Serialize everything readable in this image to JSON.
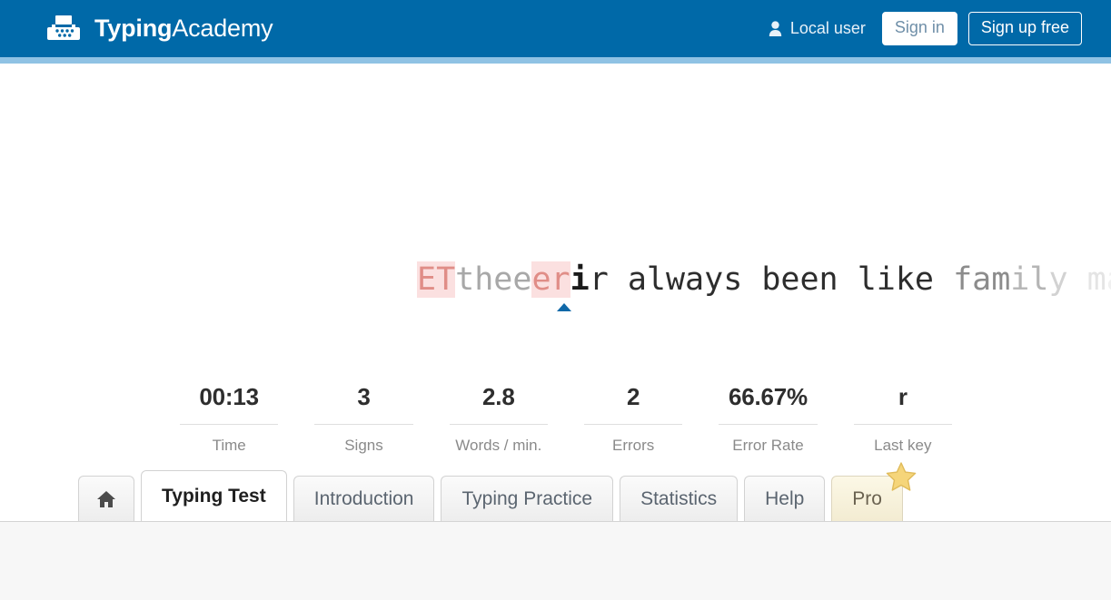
{
  "header": {
    "brand_strong": "Typing",
    "brand_light": "Academy",
    "brand_icon": "typewriter-icon",
    "user_icon": "person-icon",
    "user_label": "Local user",
    "sign_in_label": "Sign in",
    "sign_up_label": "Sign up free",
    "background_color": "#0069a8",
    "accent_color": "#8fc2e4"
  },
  "typing": {
    "segments": [
      {
        "text": "ET",
        "state": "error"
      },
      {
        "text": "thee",
        "state": "done"
      },
      {
        "text": "er",
        "state": "error"
      },
      {
        "text": "i",
        "state": "current"
      },
      {
        "text": "r always been like ",
        "state": "todo"
      },
      {
        "text": "fam",
        "state": "fade1"
      },
      {
        "text": "il",
        "state": "fade2"
      },
      {
        "text": "y",
        "state": "fade3"
      },
      {
        "text": " m",
        "state": "fade4"
      },
      {
        "text": "a",
        "state": "fade5"
      }
    ],
    "caret_icon": "caret-triangle-icon",
    "caret_color": "#1068a8",
    "error_text_color": "#e08d87",
    "error_bg_color": "#fbe0e0"
  },
  "stats": [
    {
      "value": "00:13",
      "label": "Time"
    },
    {
      "value": "3",
      "label": "Signs"
    },
    {
      "value": "2.8",
      "label": "Words / min."
    },
    {
      "value": "2",
      "label": "Errors"
    },
    {
      "value": "66.67%",
      "label": "Error Rate"
    },
    {
      "value": "r",
      "label": "Last key"
    }
  ],
  "tabs": [
    {
      "label": "",
      "icon": "home-icon",
      "active": false,
      "kind": "home"
    },
    {
      "label": "Typing Test",
      "active": true,
      "kind": "normal"
    },
    {
      "label": "Introduction",
      "active": false,
      "kind": "normal"
    },
    {
      "label": "Typing Practice",
      "active": false,
      "kind": "normal"
    },
    {
      "label": "Statistics",
      "active": false,
      "kind": "normal"
    },
    {
      "label": "Help",
      "active": false,
      "kind": "normal"
    },
    {
      "label": "Pro",
      "active": false,
      "kind": "pro",
      "badge_icon": "star-icon"
    }
  ]
}
